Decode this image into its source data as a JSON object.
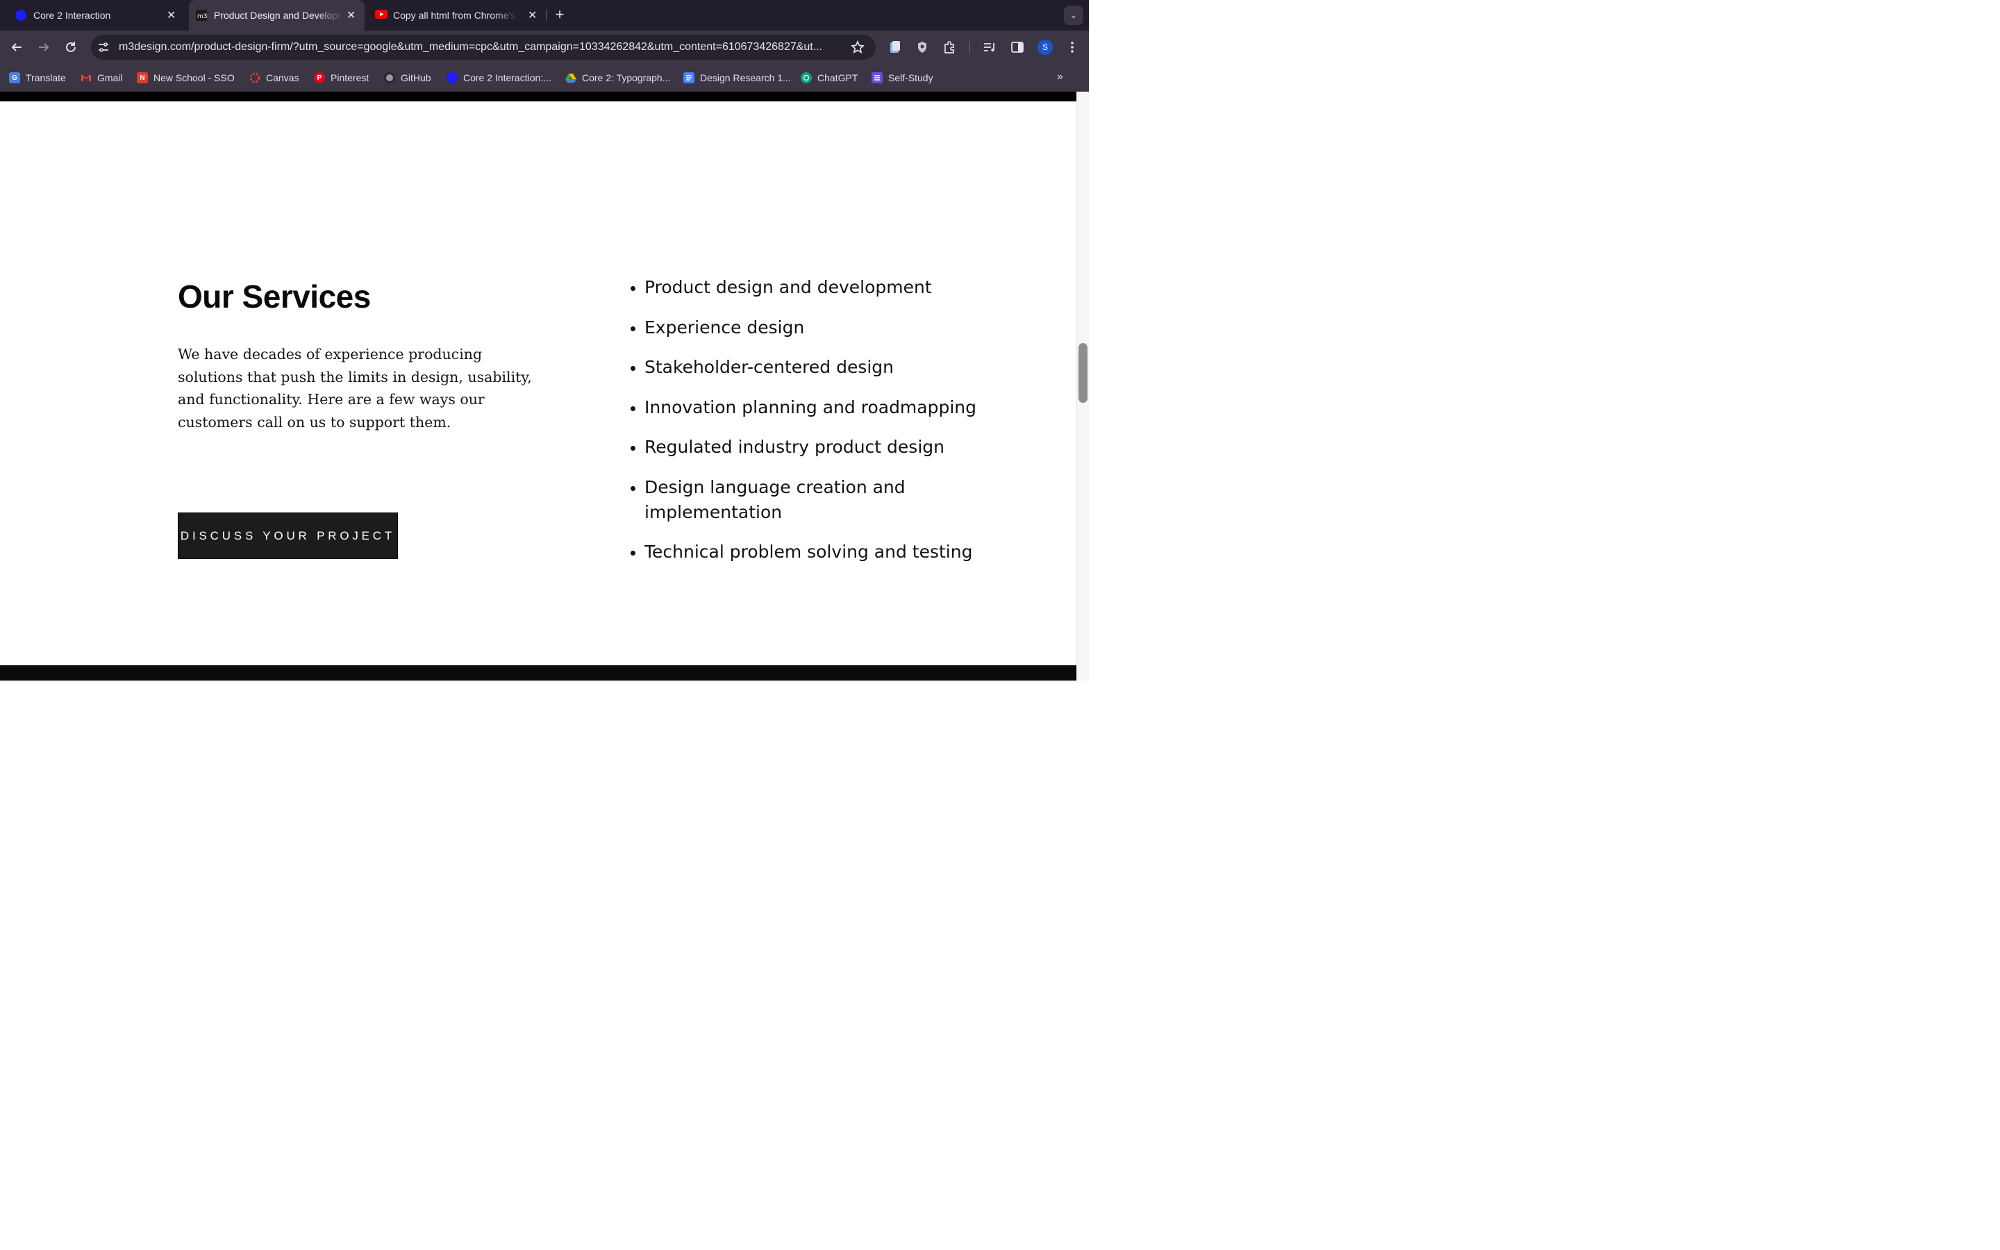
{
  "tabs": [
    {
      "title": "Core 2 Interaction",
      "icon": "blue-circle-favicon",
      "active": false
    },
    {
      "title": "Product Design and Development",
      "icon": "m3-favicon",
      "active": true
    },
    {
      "title": "Copy all html from Chrome's I",
      "icon": "youtube-favicon",
      "active": false
    }
  ],
  "address_bar": {
    "url": "m3design.com/product-design-firm/?utm_source=google&utm_medium=cpc&utm_campaign=10334262842&utm_content=610673426827&ut..."
  },
  "profile": {
    "initial": "S"
  },
  "bookmarks": [
    {
      "label": "Translate",
      "icon": "translate-icon",
      "color": "#4a7fe0"
    },
    {
      "label": "Gmail",
      "icon": "gmail-icon",
      "color": "#ea4335"
    },
    {
      "label": "New School - SSO",
      "icon": "new-school-icon",
      "color": "#e03c31"
    },
    {
      "label": "Canvas",
      "icon": "canvas-icon",
      "color": "#e23f33"
    },
    {
      "label": "Pinterest",
      "icon": "pinterest-icon",
      "color": "#e60023"
    },
    {
      "label": "GitHub",
      "icon": "github-icon",
      "color": "#9a96a4"
    },
    {
      "label": "Core 2 Interaction:...",
      "icon": "blue-circle-icon",
      "color": "#1d1dff"
    },
    {
      "label": "Core 2: Typograph...",
      "icon": "google-drive-icon",
      "color": "#34a853"
    },
    {
      "label": "Design Research 1...",
      "icon": "google-docs-icon",
      "color": "#4285f4"
    },
    {
      "label": "ChatGPT",
      "icon": "chatgpt-icon",
      "color": "#10a37f"
    },
    {
      "label": "Self-Study",
      "icon": "list-icon",
      "color": "#6b4fd8"
    }
  ],
  "services_section": {
    "heading": "Our Services",
    "intro": "We have decades of experience producing solutions that push the limits in design, usability, and functionality. Here are a few ways our customers call on us to support them.",
    "cta_label": "DISCUSS YOUR PROJECT",
    "items": [
      "Product design and development",
      "Experience design",
      "Stakeholder-centered design",
      "Innovation planning and roadmapping",
      "Regulated industry product design",
      "Design language creation and implementation",
      "Technical problem solving and testing"
    ]
  }
}
